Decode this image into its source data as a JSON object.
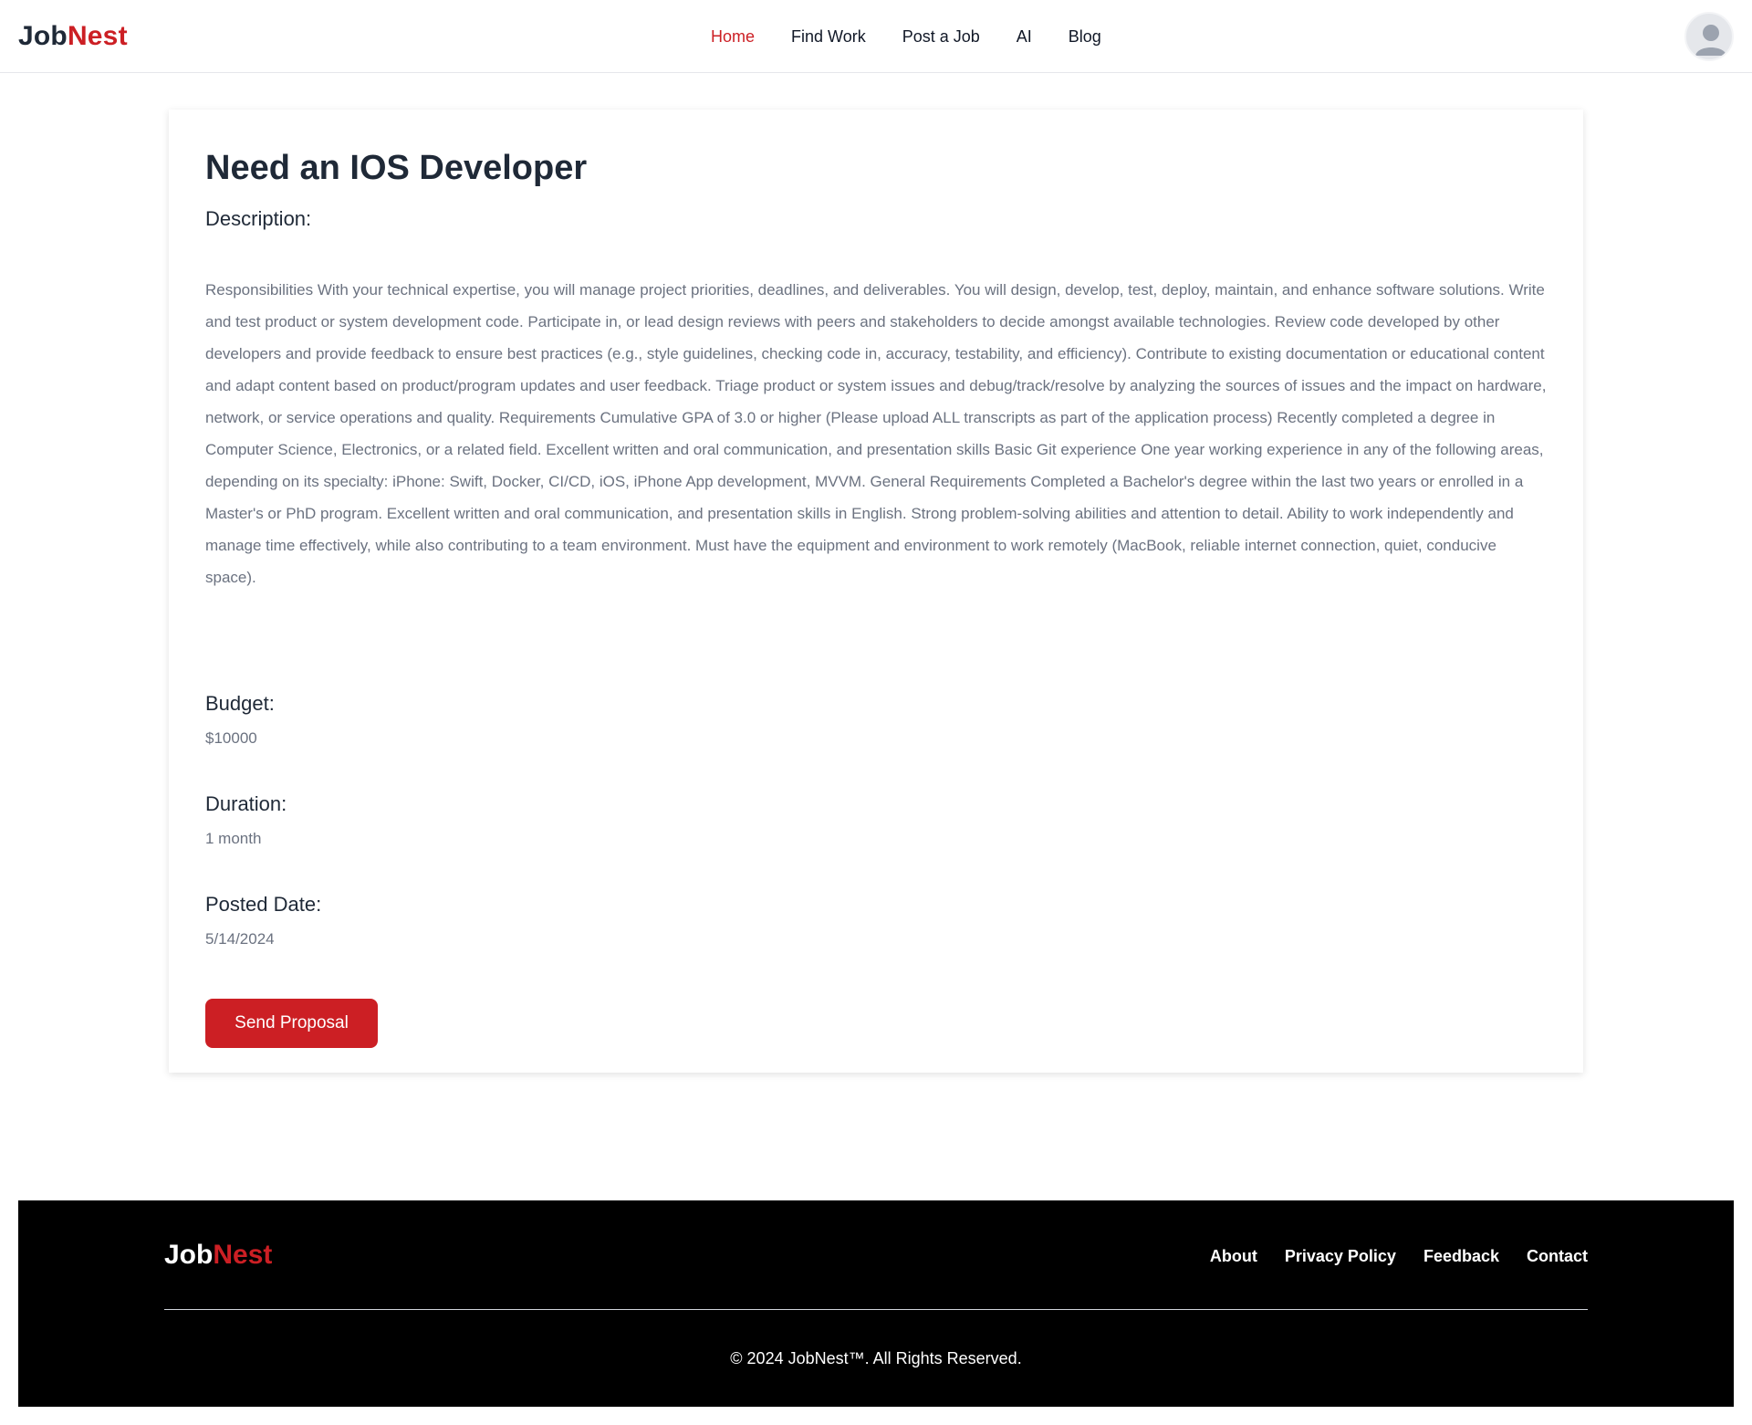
{
  "header": {
    "logo_part1": "Job",
    "logo_part2": "Nest",
    "nav": [
      "Home",
      "Find Work",
      "Post a Job",
      "AI",
      "Blog"
    ],
    "active_nav": "Home",
    "avatar_icon": "user-avatar-icon"
  },
  "job": {
    "title": "Need an IOS Developer",
    "description_label": "Description:",
    "description": "Responsibilities With your technical expertise, you will manage project priorities, deadlines, and deliverables. You will design, develop, test, deploy, maintain, and enhance software solutions. Write and test product or system development code. Participate in, or lead design reviews with peers and stakeholders to decide amongst available technologies. Review code developed by other developers and provide feedback to ensure best practices (e.g., style guidelines, checking code in, accuracy, testability, and efficiency). Contribute to existing documentation or educational content and adapt content based on product/program updates and user feedback. Triage product or system issues and debug/track/resolve by analyzing the sources of issues and the impact on hardware, network, or service operations and quality. Requirements Cumulative GPA of 3.0 or higher (Please upload ALL transcripts as part of the application process) Recently completed a degree in Computer Science, Electronics, or a related field. Excellent written and oral communication, and presentation skills Basic Git experience One year working experience in any of the following areas, depending on its specialty: iPhone: Swift, Docker, CI/CD, iOS, iPhone App development, MVVM. General Requirements Completed a Bachelor's degree within the last two years or enrolled in a Master's or PhD program. Excellent written and oral communication, and presentation skills in English. Strong problem-solving abilities and attention to detail. Ability to work independently and manage time effectively, while also contributing to a team environment. Must have the equipment and environment to work remotely (MacBook, reliable internet connection, quiet, conducive space).",
    "budget_label": "Budget:",
    "budget": "$10000",
    "duration_label": "Duration:",
    "duration": "1 month",
    "posted_label": "Posted Date:",
    "posted": "5/14/2024",
    "send_button": "Send Proposal"
  },
  "footer": {
    "logo_part1": "Job",
    "logo_part2": "Nest",
    "links": [
      "About",
      "Privacy Policy",
      "Feedback",
      "Contact"
    ],
    "copyright": "© 2024 JobNest™. All Rights Reserved."
  },
  "colors": {
    "brand_red": "#cc1f24",
    "text_dark": "#1f2937",
    "text_muted": "#6b7280",
    "footer_bg": "#000000"
  }
}
